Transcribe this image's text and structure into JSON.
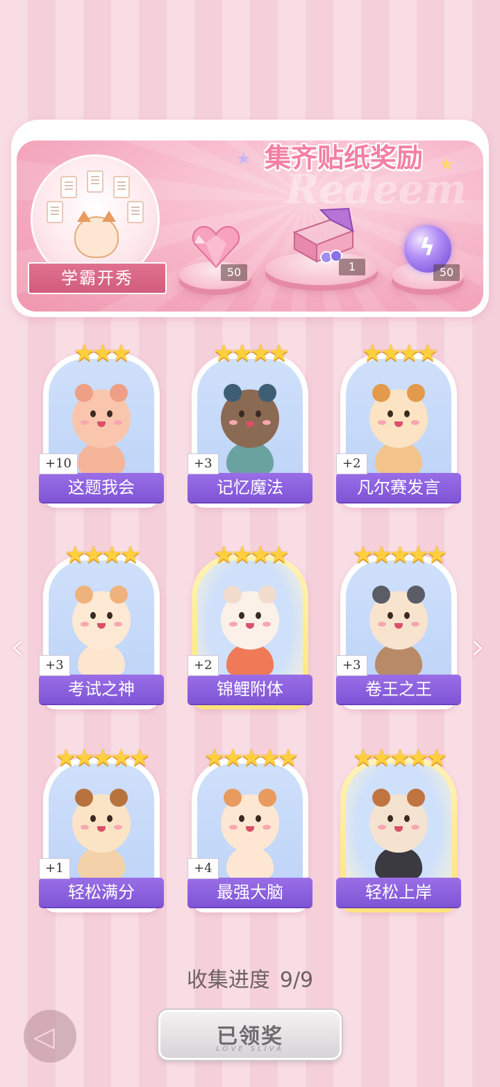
{
  "banner": {
    "title": "集齐贴纸奖励",
    "watermark": "Redeem",
    "feature_label": "学霸开秀",
    "rewards": [
      {
        "icon": "pink-heart-gem-icon",
        "count": "50"
      },
      {
        "icon": "gift-box-icon",
        "count": "1"
      },
      {
        "icon": "purple-lightning-orb-icon",
        "count": "50"
      }
    ]
  },
  "stickers": [
    {
      "name": "这题我会",
      "bonus": "+10",
      "stars": "★★★",
      "gold": false,
      "body": "#f5b59a",
      "face": "#f9c6ad",
      "ear": "#ef9f85"
    },
    {
      "name": "记忆魔法",
      "bonus": "+3",
      "stars": "★★★★",
      "gold": false,
      "body": "#6aa2a0",
      "face": "#8a6a52",
      "ear": "#3e5e74"
    },
    {
      "name": "凡尔赛发言",
      "bonus": "+2",
      "stars": "★★★★",
      "gold": false,
      "body": "#f2c48c",
      "face": "#fbe3c3",
      "ear": "#e39a4c"
    },
    {
      "name": "考试之神",
      "bonus": "+3",
      "stars": "★★★★",
      "gold": false,
      "body": "#fde6cf",
      "face": "#fde9d4",
      "ear": "#f0b27c"
    },
    {
      "name": "锦鲤附体",
      "bonus": "+2",
      "stars": "★★★★",
      "gold": true,
      "body": "#ef7a58",
      "face": "#fbf1e8",
      "ear": "#f2dccd"
    },
    {
      "name": "卷王之王",
      "bonus": "+3",
      "stars": "★★★★★",
      "gold": false,
      "body": "#b98a68",
      "face": "#f8e3cf",
      "ear": "#5c5c66"
    },
    {
      "name": "轻松满分",
      "bonus": "+1",
      "stars": "★★★★★",
      "gold": false,
      "body": "#f3d1a9",
      "face": "#fbe4c6",
      "ear": "#b8723e"
    },
    {
      "name": "最强大脑",
      "bonus": "+4",
      "stars": "★★★★★",
      "gold": false,
      "body": "#fde7d2",
      "face": "#fde7d2",
      "ear": "#e99a5e"
    },
    {
      "name": "轻松上岸",
      "bonus": "",
      "stars": "★★★★★",
      "gold": true,
      "body": "#3b3a40",
      "face": "#f4e3d0",
      "ear": "#c07440"
    }
  ],
  "progress": {
    "label": "收集进度",
    "value": "9/9"
  },
  "buttons": {
    "claim": "已领奖",
    "claim_sub": "LOVE SLIVA",
    "back_icon": "back-arrow-icon"
  },
  "colors": {
    "accent": "#8a5fdc",
    "banner": "#f4a8bd",
    "title": "#f47fa4"
  }
}
